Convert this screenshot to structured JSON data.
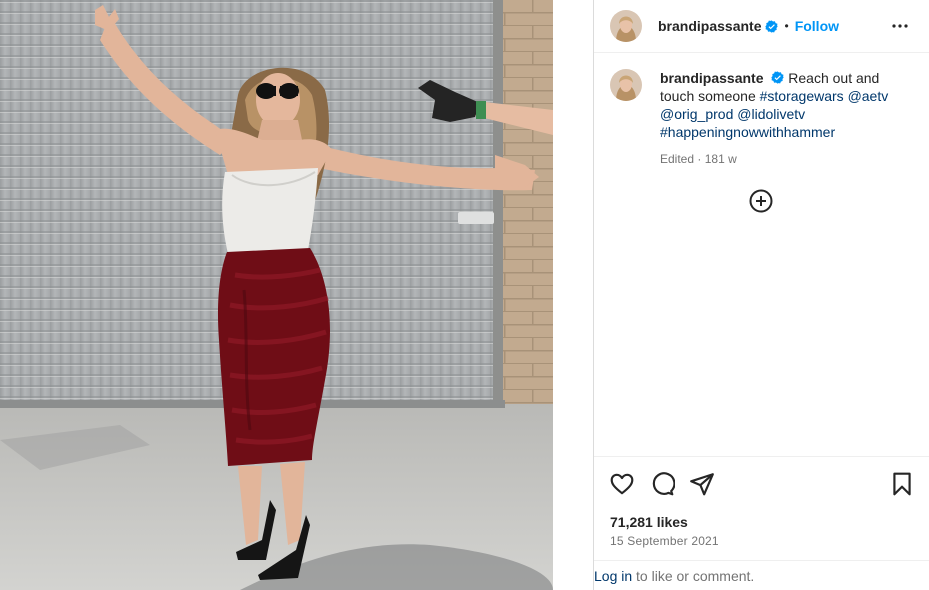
{
  "post": {
    "username": "brandipassante",
    "follow_label": "Follow",
    "separator": "•",
    "caption": {
      "username": "brandipassante",
      "text": "Reach out and touch someone",
      "tags": [
        "#storagewars",
        "@aetv",
        "@orig_prod",
        "@lidolivetv",
        "#happeningnowwithhammer"
      ]
    },
    "edited": "Edited",
    "age": "181 w",
    "likes": "71,281 likes",
    "date": "15 September 2021"
  },
  "login_bar": {
    "link": "Log in",
    "text": " to like or comment."
  },
  "icons": {
    "verified": "verified-badge-icon",
    "more": "more-options-icon",
    "add_comment": "add-circle-icon",
    "like": "heart-icon",
    "comment": "comment-icon",
    "share": "paper-plane-icon",
    "save": "bookmark-icon"
  },
  "colors": {
    "follow": "#0095f6",
    "hashtag": "#00376b",
    "muted": "#737373",
    "verified": "#0095f6"
  }
}
